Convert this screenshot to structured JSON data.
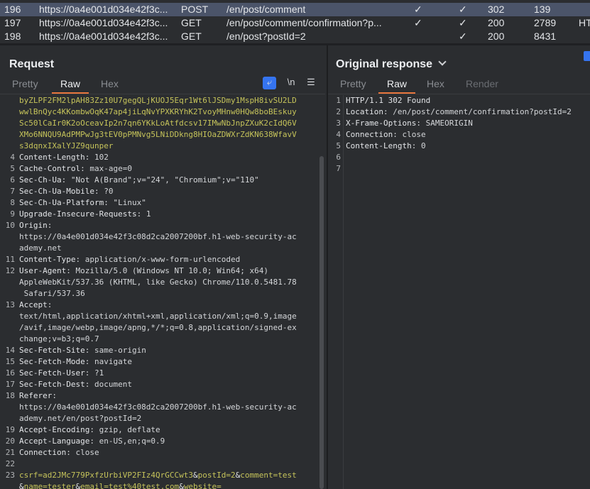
{
  "history": [
    {
      "id": "196",
      "host": "https://0a4e001d034e42f3c...",
      "method": "POST",
      "url": "/en/post/comment",
      "edited": "✓",
      "params": "✓",
      "status": "302",
      "length": "139",
      "mime": "",
      "selected": true
    },
    {
      "id": "197",
      "host": "https://0a4e001d034e42f3c...",
      "method": "GET",
      "url": "/en/post/comment/confirmation?p...",
      "edited": "✓",
      "params": "✓",
      "status": "200",
      "length": "2789",
      "mime": "HT",
      "selected": false
    },
    {
      "id": "198",
      "host": "https://0a4e001d034e42f3c...",
      "method": "GET",
      "url": "/en/post?postId=2",
      "edited": "",
      "params": "✓",
      "status": "200",
      "length": "8431",
      "mime": "",
      "selected": false
    }
  ],
  "request": {
    "title": "Request",
    "tabs": [
      "Pretty",
      "Raw",
      "Hex"
    ],
    "active_tab": "Raw",
    "tools": {
      "wrap": "⤶",
      "newline": "\\n",
      "menu": "☰"
    },
    "lines": [
      {
        "n": "",
        "parts": [
          {
            "t": "byZLPF2FM2lpAH83Zz10U7gegQLjKUOJ5Eqr1Wt6lJSDmy1MspH8ivSU2LD",
            "c": "cookie"
          }
        ]
      },
      {
        "n": "",
        "parts": [
          {
            "t": "wwlBnQyc4KKombwOqK47ap4jiLqNvYPXKRYhK2TvoyMHnw0HQw8boBEskuy",
            "c": "cookie"
          }
        ]
      },
      {
        "n": "",
        "parts": [
          {
            "t": "Sc50lCaIr0K2oOceavIp2n7qn6YKkLoAtfdcsv17IMwNbJnpZXuK2cIdQ6V",
            "c": "cookie"
          }
        ]
      },
      {
        "n": "",
        "parts": [
          {
            "t": "XMo6NNQU9AdPMPwJg3tEV0pPMNvg5LNiDDkng8HIOaZDWXrZdKN638WfavV",
            "c": "cookie"
          }
        ]
      },
      {
        "n": "",
        "parts": [
          {
            "t": "s3dqnxIXalYJZ9qunper",
            "c": "cookie"
          }
        ]
      },
      {
        "n": "4",
        "parts": [
          {
            "t": "Content-Length",
            "c": "k"
          },
          {
            "t": ": 102",
            "c": "v"
          }
        ]
      },
      {
        "n": "5",
        "parts": [
          {
            "t": "Cache-Control",
            "c": "k"
          },
          {
            "t": ": max-age=0",
            "c": "v"
          }
        ]
      },
      {
        "n": "6",
        "parts": [
          {
            "t": "Sec-Ch-Ua",
            "c": "k"
          },
          {
            "t": ": \"Not A(Brand\";v=\"24\", \"Chromium\";v=\"110\"",
            "c": "v"
          }
        ]
      },
      {
        "n": "7",
        "parts": [
          {
            "t": "Sec-Ch-Ua-Mobile",
            "c": "k"
          },
          {
            "t": ": ?0",
            "c": "v"
          }
        ]
      },
      {
        "n": "8",
        "parts": [
          {
            "t": "Sec-Ch-Ua-Platform",
            "c": "k"
          },
          {
            "t": ": \"Linux\"",
            "c": "v"
          }
        ]
      },
      {
        "n": "9",
        "parts": [
          {
            "t": "Upgrade-Insecure-Requests",
            "c": "k"
          },
          {
            "t": ": 1",
            "c": "v"
          }
        ]
      },
      {
        "n": "10",
        "parts": [
          {
            "t": "Origin",
            "c": "k"
          },
          {
            "t": ":",
            "c": "v"
          }
        ]
      },
      {
        "n": "",
        "parts": [
          {
            "t": "https://0a4e001d034e42f3c08d2ca2007200bf.h1-web-security-ac",
            "c": "v"
          }
        ]
      },
      {
        "n": "",
        "parts": [
          {
            "t": "ademy.net",
            "c": "v"
          }
        ]
      },
      {
        "n": "11",
        "parts": [
          {
            "t": "Content-Type",
            "c": "k"
          },
          {
            "t": ": application/x-www-form-urlencoded",
            "c": "v"
          }
        ]
      },
      {
        "n": "12",
        "parts": [
          {
            "t": "User-Agent",
            "c": "k"
          },
          {
            "t": ": Mozilla/5.0 (Windows NT 10.0; Win64; x64)",
            "c": "v"
          }
        ]
      },
      {
        "n": "",
        "parts": [
          {
            "t": "AppleWebKit/537.36 (KHTML, like Gecko) Chrome/110.0.5481.78",
            "c": "v"
          }
        ]
      },
      {
        "n": "",
        "parts": [
          {
            "t": " Safari/537.36",
            "c": "v"
          }
        ]
      },
      {
        "n": "13",
        "parts": [
          {
            "t": "Accept",
            "c": "k"
          },
          {
            "t": ":",
            "c": "v"
          }
        ]
      },
      {
        "n": "",
        "parts": [
          {
            "t": "text/html,application/xhtml+xml,application/xml;q=0.9,image",
            "c": "v"
          }
        ]
      },
      {
        "n": "",
        "parts": [
          {
            "t": "/avif,image/webp,image/apng,*/*;q=0.8,application/signed-ex",
            "c": "v"
          }
        ]
      },
      {
        "n": "",
        "parts": [
          {
            "t": "change;v=b3;q=0.7",
            "c": "v"
          }
        ]
      },
      {
        "n": "14",
        "parts": [
          {
            "t": "Sec-Fetch-Site",
            "c": "k"
          },
          {
            "t": ": same-origin",
            "c": "v"
          }
        ]
      },
      {
        "n": "15",
        "parts": [
          {
            "t": "Sec-Fetch-Mode",
            "c": "k"
          },
          {
            "t": ": navigate",
            "c": "v"
          }
        ]
      },
      {
        "n": "16",
        "parts": [
          {
            "t": "Sec-Fetch-User",
            "c": "k"
          },
          {
            "t": ": ?1",
            "c": "v"
          }
        ]
      },
      {
        "n": "17",
        "parts": [
          {
            "t": "Sec-Fetch-Dest",
            "c": "k"
          },
          {
            "t": ": document",
            "c": "v"
          }
        ]
      },
      {
        "n": "18",
        "parts": [
          {
            "t": "Referer",
            "c": "k"
          },
          {
            "t": ":",
            "c": "v"
          }
        ]
      },
      {
        "n": "",
        "parts": [
          {
            "t": "https://0a4e001d034e42f3c08d2ca2007200bf.h1-web-security-ac",
            "c": "v"
          }
        ]
      },
      {
        "n": "",
        "parts": [
          {
            "t": "ademy.net/en/post?postId=2",
            "c": "v"
          }
        ]
      },
      {
        "n": "19",
        "parts": [
          {
            "t": "Accept-Encoding",
            "c": "k"
          },
          {
            "t": ": gzip, deflate",
            "c": "v"
          }
        ]
      },
      {
        "n": "20",
        "parts": [
          {
            "t": "Accept-Language",
            "c": "k"
          },
          {
            "t": ": en-US,en;q=0.9",
            "c": "v"
          }
        ]
      },
      {
        "n": "21",
        "parts": [
          {
            "t": "Connection",
            "c": "k"
          },
          {
            "t": ": close",
            "c": "v"
          }
        ]
      },
      {
        "n": "22",
        "parts": [
          {
            "t": "",
            "c": "v"
          }
        ]
      },
      {
        "n": "23",
        "parts": [
          {
            "t": "csrf=ad2JMc779PxfzUrbiVP2FIz4QrGCCwt3",
            "c": "param"
          },
          {
            "t": "&",
            "c": "amp"
          },
          {
            "t": "postId=2",
            "c": "param"
          },
          {
            "t": "&",
            "c": "amp"
          },
          {
            "t": "comment=test",
            "c": "param"
          }
        ]
      },
      {
        "n": "",
        "parts": [
          {
            "t": "&",
            "c": "amp"
          },
          {
            "t": "name=tester",
            "c": "param"
          },
          {
            "t": "&",
            "c": "amp"
          },
          {
            "t": "email=test%40test.com",
            "c": "param"
          },
          {
            "t": "&",
            "c": "amp"
          },
          {
            "t": "website=",
            "c": "param"
          }
        ]
      }
    ]
  },
  "response": {
    "title": "Original response",
    "tabs": [
      "Pretty",
      "Raw",
      "Hex",
      "Render"
    ],
    "active_tab": "Raw",
    "lines": [
      {
        "n": "1",
        "parts": [
          {
            "t": "HTTP/1.1 302 Found",
            "c": "k"
          }
        ]
      },
      {
        "n": "2",
        "parts": [
          {
            "t": "Location",
            "c": "k"
          },
          {
            "t": ": /en/post/comment/confirmation?postId=2",
            "c": "v"
          }
        ]
      },
      {
        "n": "3",
        "parts": [
          {
            "t": "X-Frame-Options",
            "c": "k"
          },
          {
            "t": ": SAMEORIGIN",
            "c": "v"
          }
        ]
      },
      {
        "n": "4",
        "parts": [
          {
            "t": "Connection",
            "c": "k"
          },
          {
            "t": ": close",
            "c": "v"
          }
        ]
      },
      {
        "n": "5",
        "parts": [
          {
            "t": "Content-Length",
            "c": "k"
          },
          {
            "t": ": 0",
            "c": "v"
          }
        ]
      },
      {
        "n": "6",
        "parts": [
          {
            "t": "",
            "c": "v"
          }
        ]
      },
      {
        "n": "7",
        "parts": [
          {
            "t": "",
            "c": "v"
          }
        ]
      }
    ]
  },
  "colors": {
    "accent": "#e8763d",
    "selection": "#4b5469",
    "wrap_button": "#3574f0",
    "param_text": "#c5c35a"
  }
}
